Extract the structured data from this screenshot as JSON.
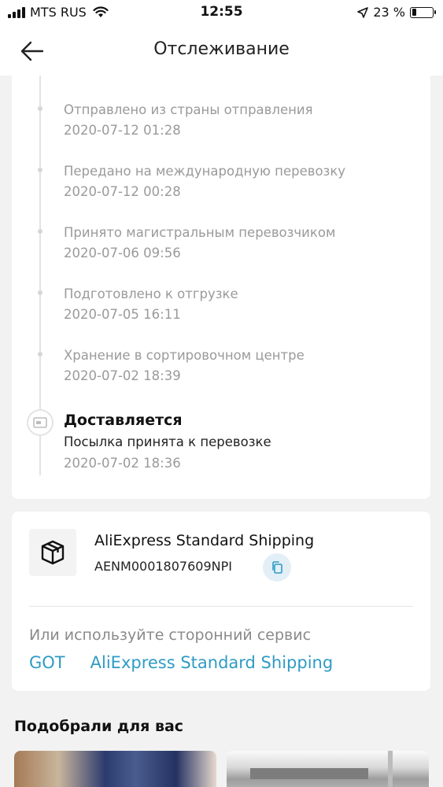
{
  "status_bar": {
    "carrier": "MTS RUS",
    "time": "12:55",
    "battery_percent": "23 %",
    "battery_level": 0.23
  },
  "header": {
    "title": "Отслеживание",
    "back_icon": "arrow-left-icon"
  },
  "timeline": {
    "events": [
      {
        "text": "Отправлено из страны отправления",
        "date": "2020-07-12 01:28"
      },
      {
        "text": "Передано на международную перевозку",
        "date": "2020-07-12 00:28"
      },
      {
        "text": "Принято магистральным перевозчиком",
        "date": "2020-07-06 09:56"
      },
      {
        "text": "Подготовлено к отгрузке",
        "date": "2020-07-05 16:11"
      },
      {
        "text": "Хранение в сортировочном центре",
        "date": "2020-07-02 18:39"
      }
    ],
    "current": {
      "title": "Доставляется",
      "text": "Посылка принята к перевозке",
      "date": "2020-07-02 18:36",
      "icon": "package-card-icon"
    }
  },
  "shipping": {
    "service_name": "AliExpress Standard Shipping",
    "tracking_number": "AENM0001807609NPI",
    "box_icon": "box-icon",
    "copy_icon": "copy-icon",
    "alt_label": "Или используйте сторонний сервис",
    "alt_links": [
      "GOT",
      "AliExpress Standard Shipping"
    ]
  },
  "recommendations": {
    "title": "Подобрали для вас"
  },
  "colors": {
    "accent_link": "#2f9bc4",
    "background": "#f2f2f2",
    "copy_bg": "#e3eff7"
  }
}
